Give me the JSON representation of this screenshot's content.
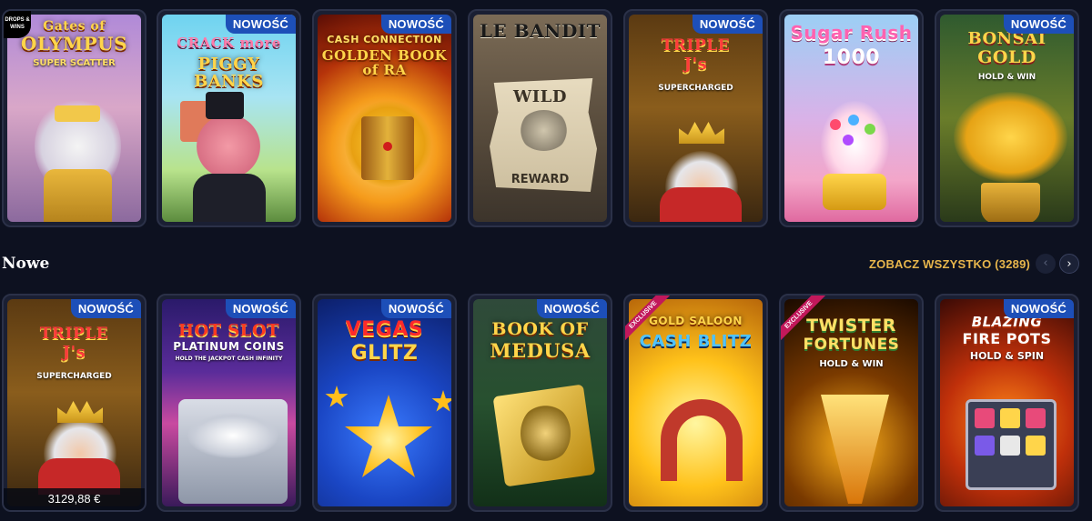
{
  "top_row": [
    {
      "title": "Gates of",
      "title2": "OLYMPUS",
      "subtitle": "SUPER SCATTER",
      "badge": "",
      "drops": "DROPS & WINS"
    },
    {
      "title": "CRACK more",
      "title2": "PIGGY BANKS",
      "subtitle": "",
      "badge": "NOWOŚĆ"
    },
    {
      "title": "CASH CONNECTION",
      "title2": "GOLDEN BOOK of RA",
      "subtitle": "",
      "badge": "NOWOŚĆ"
    },
    {
      "title": "LE BANDIT",
      "title2": "WILD",
      "subtitle": "REWARD",
      "badge": ""
    },
    {
      "title": "TRIPLE",
      "title2": "J's",
      "subtitle": "SUPERCHARGED",
      "badge": "NOWOŚĆ"
    },
    {
      "title": "Sugar Rush",
      "title2": "1000",
      "subtitle": "",
      "badge": ""
    },
    {
      "title": "BONSAI",
      "title2": "GOLD",
      "subtitle": "HOLD & WIN",
      "badge": "NOWOŚĆ"
    }
  ],
  "section": {
    "title": "Nowe",
    "see_all": "ZOBACZ WSZYSTKO (3289)",
    "prev_icon": "‹",
    "next_icon": "›"
  },
  "bottom_row": [
    {
      "title": "TRIPLE",
      "title2": "J's",
      "subtitle": "SUPERCHARGED",
      "badge": "NOWOŚĆ",
      "price": "3129,88 €"
    },
    {
      "title": "HOT SLOT",
      "title2": "PLATINUM COINS",
      "subtitle": "HOLD THE JACKPOT CASH INFINITY",
      "badge": "NOWOŚĆ"
    },
    {
      "title": "VEGAS",
      "title2": "GLITZ",
      "subtitle": "",
      "badge": "NOWOŚĆ"
    },
    {
      "title": "BOOK OF",
      "title2": "MEDUSA",
      "subtitle": "",
      "badge": "NOWOŚĆ"
    },
    {
      "title": "GOLD SALOON",
      "title2": "CASH BLITZ",
      "subtitle": "",
      "badge": "",
      "ribbon": "EXCLUSIVE"
    },
    {
      "title": "TWISTER",
      "title2": "FORTUNES",
      "subtitle": "HOLD & WIN",
      "badge": "",
      "ribbon": "EXCLUSIVE"
    },
    {
      "title": "BLAZING",
      "title2": "FIRE POTS",
      "subtitle": "HOLD & SPIN",
      "badge": "NOWOŚĆ"
    }
  ]
}
